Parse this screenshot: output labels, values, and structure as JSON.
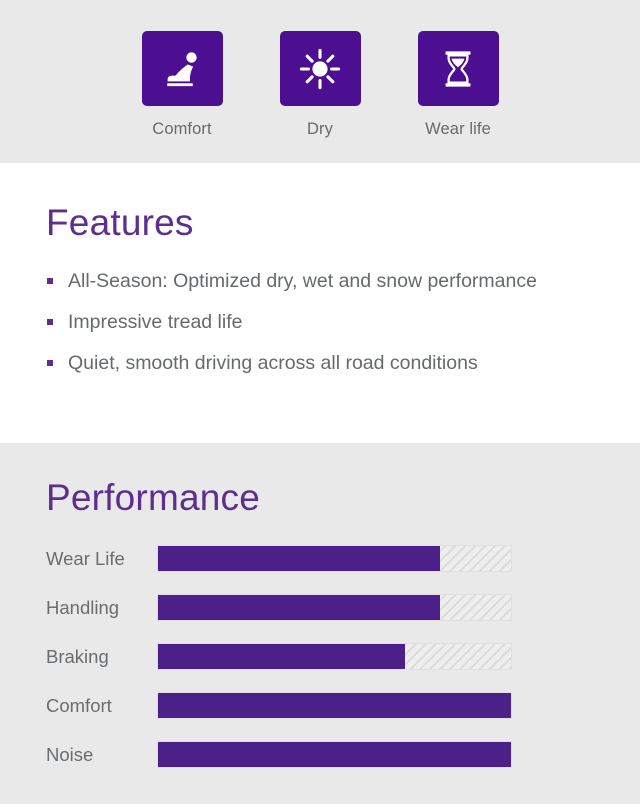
{
  "badges": [
    {
      "icon": "car-seat-icon",
      "label": "Comfort"
    },
    {
      "icon": "sun-icon",
      "label": "Dry"
    },
    {
      "icon": "hourglass-icon",
      "label": "Wear life"
    }
  ],
  "features": {
    "title": "Features",
    "items": [
      "All-Season: Optimized dry, wet and snow performance",
      "Impressive tread life",
      "Quiet, smooth driving across all road conditions"
    ]
  },
  "performance": {
    "title": "Performance"
  },
  "chart_data": {
    "type": "bar",
    "title": "Performance",
    "orientation": "horizontal",
    "categories": [
      "Wear Life",
      "Handling",
      "Braking",
      "Comfort",
      "Noise"
    ],
    "values": [
      80,
      80,
      70,
      100,
      100
    ],
    "xlabel": "",
    "ylabel": "",
    "xlim": [
      0,
      100
    ],
    "grid": false,
    "legend": false,
    "value_labels_shown": false,
    "fill_color": "#4b2088",
    "track_color": "#e3e3e3",
    "track_pattern": "diagonal-hatch"
  },
  "colors": {
    "brand_purple": "#4d0f92",
    "heading_purple": "#5d2e8f",
    "bar_purple": "#4b2088",
    "band_gray": "#e9e9e9",
    "text_gray": "#66696d"
  }
}
